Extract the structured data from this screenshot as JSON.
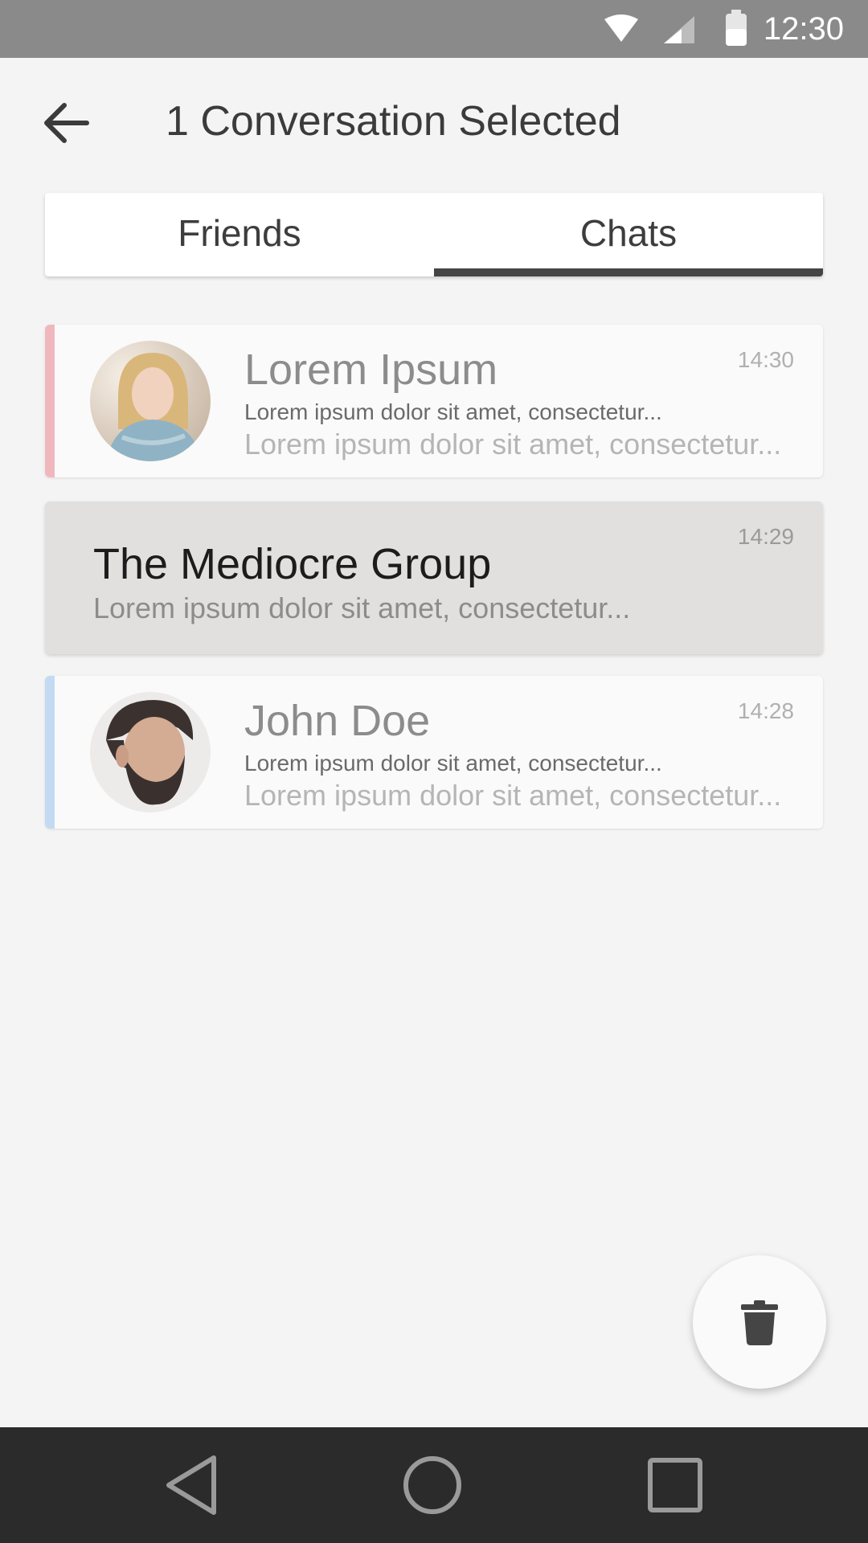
{
  "status_bar": {
    "time": "12:30",
    "icons": [
      "wifi-icon",
      "signal-icon",
      "battery-icon"
    ]
  },
  "app_bar": {
    "title": "1 Conversation Selected",
    "back_icon": "arrow-left-icon"
  },
  "tabs": [
    {
      "label": "Friends",
      "active": false
    },
    {
      "label": "Chats",
      "active": true
    }
  ],
  "chats": [
    {
      "name": "Lorem Ipsum",
      "preview_line1": "Lorem ipsum dolor sit amet, consectetur...",
      "preview_line2": "Lorem ipsum dolor sit amet, consectetur...",
      "time": "14:30",
      "accent_color": "#f0b8be",
      "selected": false,
      "avatar": "woman-avatar"
    },
    {
      "name": "The Mediocre Group",
      "preview_line1": "Lorem ipsum dolor sit amet, consectetur...",
      "time": "14:29",
      "selected": true
    },
    {
      "name": "John Doe",
      "preview_line1": "Lorem ipsum dolor sit amet, consectetur...",
      "preview_line2": "Lorem ipsum dolor sit amet, consectetur...",
      "time": "14:28",
      "accent_color": "#c4daf2",
      "selected": false,
      "avatar": "man-avatar"
    }
  ],
  "fab": {
    "icon": "trash-icon"
  },
  "nav_bar": {
    "icons": [
      "back-triangle-icon",
      "home-circle-icon",
      "recents-square-icon"
    ]
  },
  "colors": {
    "background": "#f4f4f4",
    "status_bar": "#8a8a8a",
    "nav_bar": "#2b2b2b",
    "tab_indicator": "#454545",
    "selected_row": "#e1e0df"
  }
}
